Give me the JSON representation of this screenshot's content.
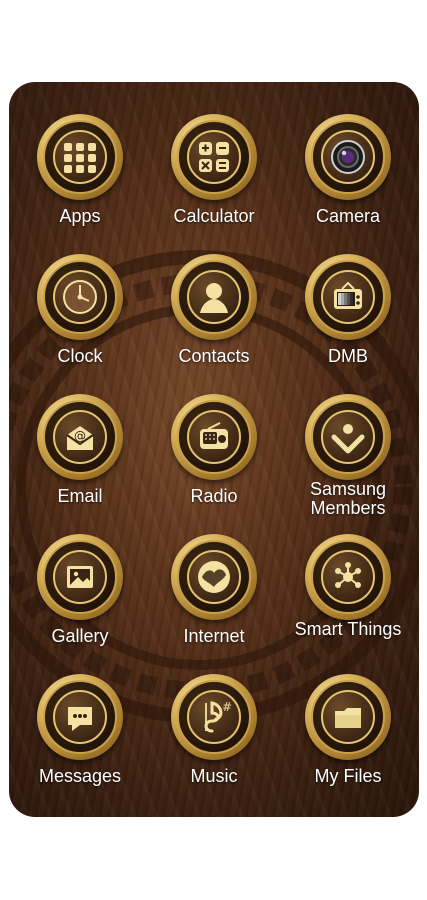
{
  "apps": [
    {
      "label": "Apps",
      "icon": "apps-grid-icon"
    },
    {
      "label": "Calculator",
      "icon": "calculator-icon"
    },
    {
      "label": "Camera",
      "icon": "camera-icon"
    },
    {
      "label": "Clock",
      "icon": "clock-icon"
    },
    {
      "label": "Contacts",
      "icon": "contacts-icon"
    },
    {
      "label": "DMB",
      "icon": "tv-icon"
    },
    {
      "label": "Email",
      "icon": "email-icon"
    },
    {
      "label": "Radio",
      "icon": "radio-icon"
    },
    {
      "label": "Samsung Members",
      "icon": "samsung-members-icon"
    },
    {
      "label": "Gallery",
      "icon": "gallery-icon"
    },
    {
      "label": "Internet",
      "icon": "globe-icon"
    },
    {
      "label": "Smart Things",
      "icon": "smartthings-icon"
    },
    {
      "label": "Messages",
      "icon": "messages-icon"
    },
    {
      "label": "Music",
      "icon": "music-icon"
    },
    {
      "label": "My Files",
      "icon": "folder-icon"
    }
  ],
  "colors": {
    "gold": "#e3c36f",
    "wood": "#5a321a"
  }
}
